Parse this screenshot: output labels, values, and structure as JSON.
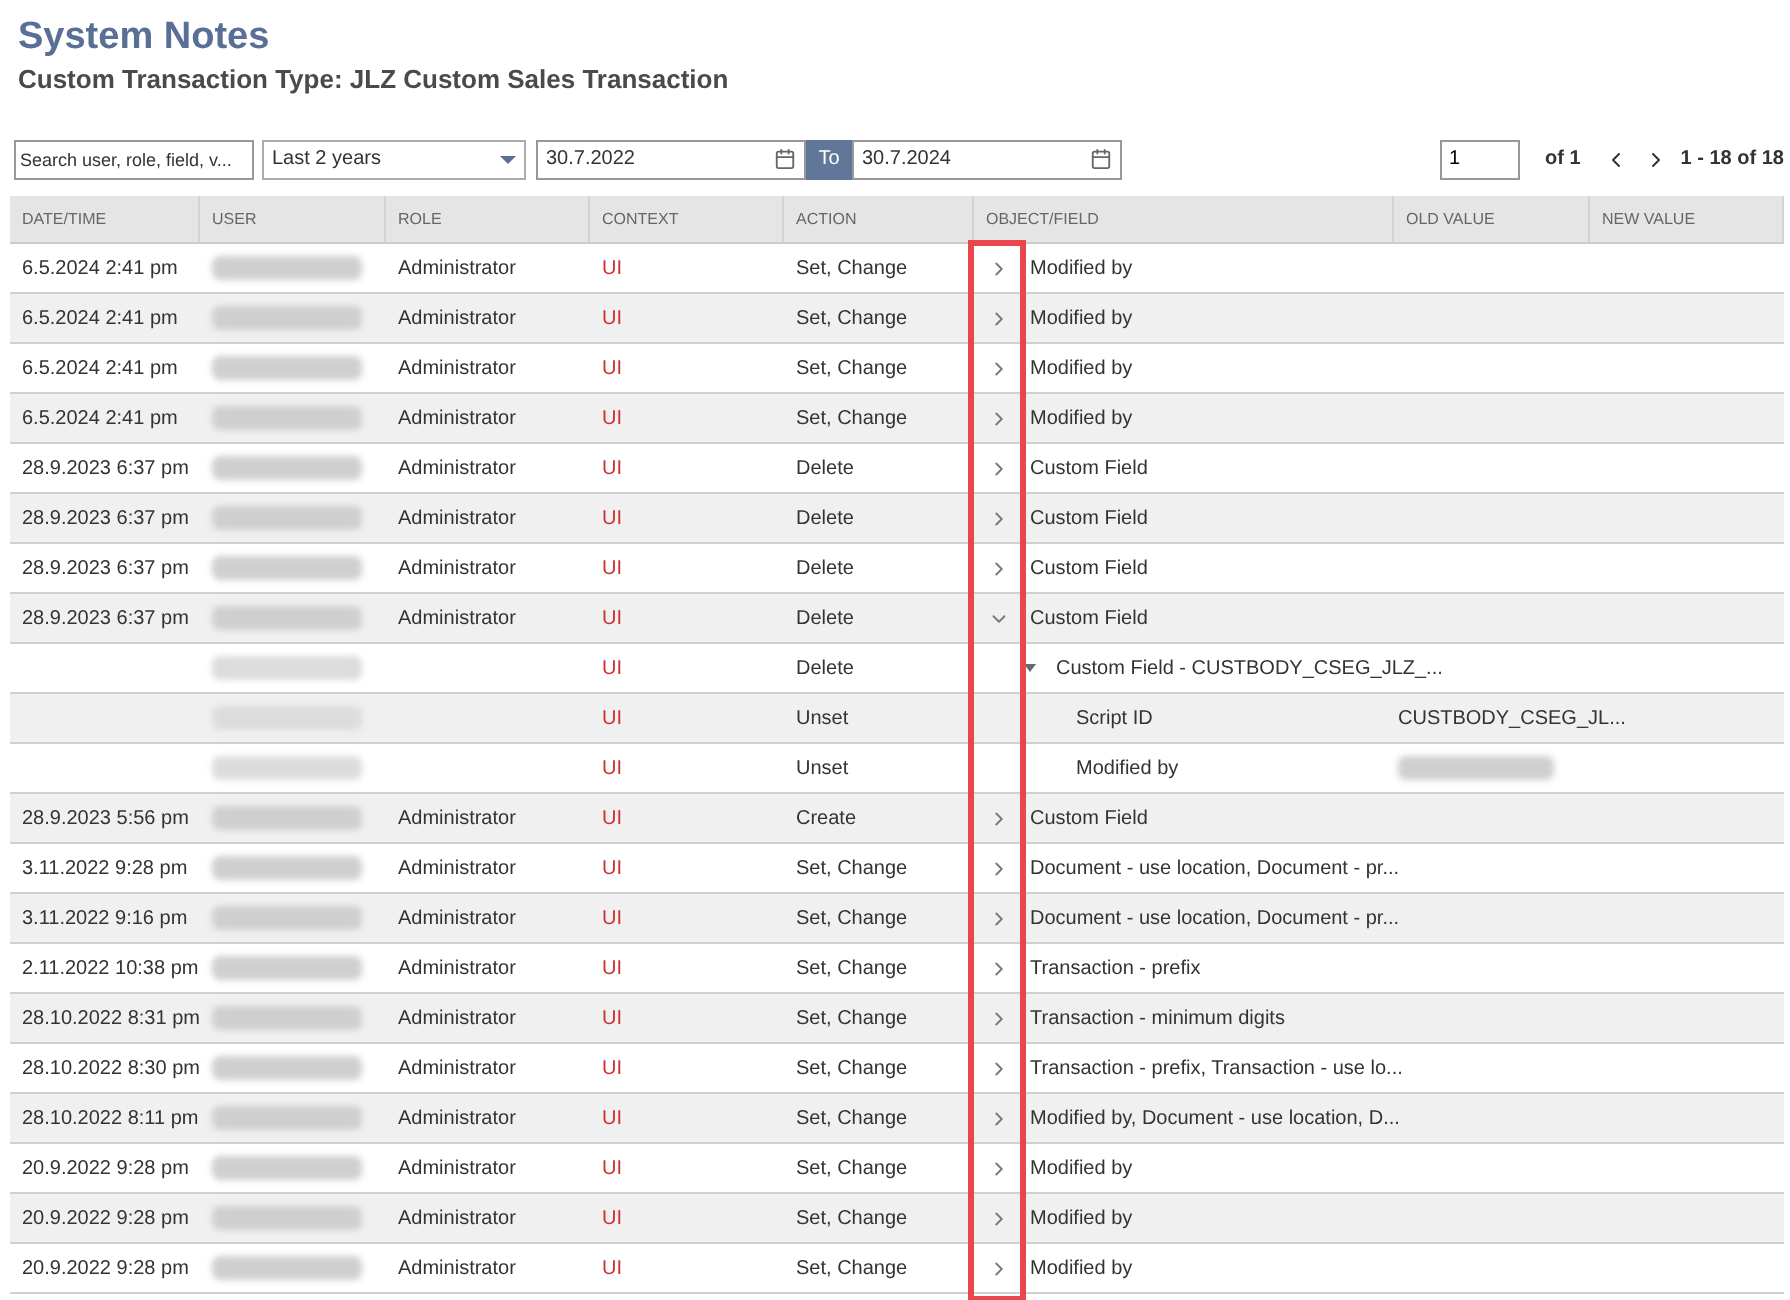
{
  "page": {
    "title": "System Notes",
    "subtitle": "Custom Transaction Type: JLZ Custom Sales Transaction"
  },
  "filters": {
    "search": {
      "placeholder": "Search user, role, field, v..."
    },
    "range": {
      "value": "Last 2 years"
    },
    "from": {
      "value": "30.7.2022"
    },
    "to_label": "To",
    "to": {
      "value": "30.7.2024"
    }
  },
  "pagination": {
    "page": "1",
    "of": "of 1",
    "range": "1 - 18 of 18"
  },
  "table": {
    "columns": [
      "DATE/TIME",
      "USER",
      "ROLE",
      "CONTEXT",
      "ACTION",
      "OBJECT/FIELD",
      "OLD VALUE",
      "NEW VALUE"
    ],
    "expander_column_highlighted": true,
    "rows": [
      {
        "date": "6.5.2024 2:41 pm",
        "user_blurred": true,
        "role": "Administrator",
        "context": "UI",
        "action": "Set, Change",
        "field": "Modified by",
        "expanded": false
      },
      {
        "date": "6.5.2024 2:41 pm",
        "user_blurred": true,
        "role": "Administrator",
        "context": "UI",
        "action": "Set, Change",
        "field": "Modified by",
        "expanded": false
      },
      {
        "date": "6.5.2024 2:41 pm",
        "user_blurred": true,
        "role": "Administrator",
        "context": "UI",
        "action": "Set, Change",
        "field": "Modified by",
        "expanded": false
      },
      {
        "date": "6.5.2024 2:41 pm",
        "user_blurred": true,
        "role": "Administrator",
        "context": "UI",
        "action": "Set, Change",
        "field": "Modified by",
        "expanded": false
      },
      {
        "date": "28.9.2023 6:37 pm",
        "user_blurred": true,
        "role": "Administrator",
        "context": "UI",
        "action": "Delete",
        "field": "Custom Field",
        "expanded": false
      },
      {
        "date": "28.9.2023 6:37 pm",
        "user_blurred": true,
        "role": "Administrator",
        "context": "UI",
        "action": "Delete",
        "field": "Custom Field",
        "expanded": false
      },
      {
        "date": "28.9.2023 6:37 pm",
        "user_blurred": true,
        "role": "Administrator",
        "context": "UI",
        "action": "Delete",
        "field": "Custom Field",
        "expanded": false
      },
      {
        "date": "28.9.2023 6:37 pm",
        "user_blurred": true,
        "role": "Administrator",
        "context": "UI",
        "action": "Delete",
        "field": "Custom Field",
        "expanded": true,
        "children": [
          {
            "user_blurred": true,
            "context": "UI",
            "action": "Delete",
            "field": "Custom Field - CUSTBODY_CSEG_JLZ_...",
            "expanded": true,
            "children": [
              {
                "user_blurred": true,
                "context": "UI",
                "action": "Unset",
                "field": "Script ID",
                "old_value": "CUSTBODY_CSEG_JL..."
              },
              {
                "user_blurred": true,
                "context": "UI",
                "action": "Unset",
                "field": "Modified by",
                "old_value_blurred": true
              }
            ]
          }
        ]
      },
      {
        "date": "28.9.2023 5:56 pm",
        "user_blurred": true,
        "role": "Administrator",
        "context": "UI",
        "action": "Create",
        "field": "Custom Field",
        "expanded": false
      },
      {
        "date": "3.11.2022 9:28 pm",
        "user_blurred": true,
        "role": "Administrator",
        "context": "UI",
        "action": "Set, Change",
        "field": "Document - use location, Document - pr...",
        "expanded": false
      },
      {
        "date": "3.11.2022 9:16 pm",
        "user_blurred": true,
        "role": "Administrator",
        "context": "UI",
        "action": "Set, Change",
        "field": "Document - use location, Document - pr...",
        "expanded": false
      },
      {
        "date": "2.11.2022 10:38 pm",
        "user_blurred": true,
        "role": "Administrator",
        "context": "UI",
        "action": "Set, Change",
        "field": "Transaction - prefix",
        "expanded": false
      },
      {
        "date": "28.10.2022 8:31 pm",
        "user_blurred": true,
        "role": "Administrator",
        "context": "UI",
        "action": "Set, Change",
        "field": "Transaction - minimum digits",
        "expanded": false
      },
      {
        "date": "28.10.2022 8:30 pm",
        "user_blurred": true,
        "role": "Administrator",
        "context": "UI",
        "action": "Set, Change",
        "field": "Transaction - prefix, Transaction - use lo...",
        "expanded": false
      },
      {
        "date": "28.10.2022 8:11 pm",
        "user_blurred": true,
        "role": "Administrator",
        "context": "UI",
        "action": "Set, Change",
        "field": "Modified by, Document - use location, D...",
        "expanded": false
      },
      {
        "date": "20.9.2022 9:28 pm",
        "user_blurred": true,
        "role": "Administrator",
        "context": "UI",
        "action": "Set, Change",
        "field": "Modified by",
        "expanded": false
      },
      {
        "date": "20.9.2022 9:28 pm",
        "user_blurred": true,
        "role": "Administrator",
        "context": "UI",
        "action": "Set, Change",
        "field": "Modified by",
        "expanded": false
      },
      {
        "date": "20.9.2022 9:28 pm",
        "user_blurred": true,
        "role": "Administrator",
        "context": "UI",
        "action": "Set, Change",
        "field": "Modified by",
        "expanded": false
      }
    ]
  }
}
